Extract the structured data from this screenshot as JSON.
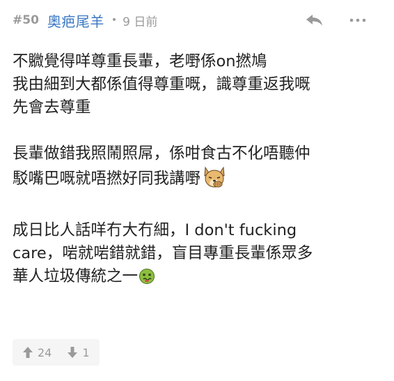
{
  "post": {
    "number": "#50",
    "author": "奧疤尾羊",
    "separator": "•",
    "time": "9 日前",
    "icons": {
      "reply": "reply-icon",
      "more": "more-icon",
      "upvote": "thumb-up-icon",
      "downvote": "thumb-down-icon",
      "dog_sticker": "facepalm-dog-icon",
      "sick_emoji": "nauseated-face-icon"
    },
    "content": {
      "p1": [
        "不覹覺得咩尊重長輩，老嘢係on撚鳩",
        "我由細到大都係值得尊重嘅，識尊重返我嘅",
        "先會去尊重"
      ],
      "p2": [
        "長輩做錯我照鬧照屌，係咁食古不化唔聽仲",
        "駁嘴巴嘅就唔撚好同我講嘢"
      ],
      "p3": [
        "成日比人話咩冇大冇細，I don't fucking",
        "care，啱就啱錯就錯，盲目專重長輩係眾多",
        "華人垃圾傳統之一"
      ]
    },
    "votes": {
      "up": "24",
      "down": "1"
    }
  },
  "colors": {
    "author": "#3a78c3",
    "meta": "#9a9a9a",
    "text": "#222222",
    "vote_bg": "#f5f5f5"
  }
}
